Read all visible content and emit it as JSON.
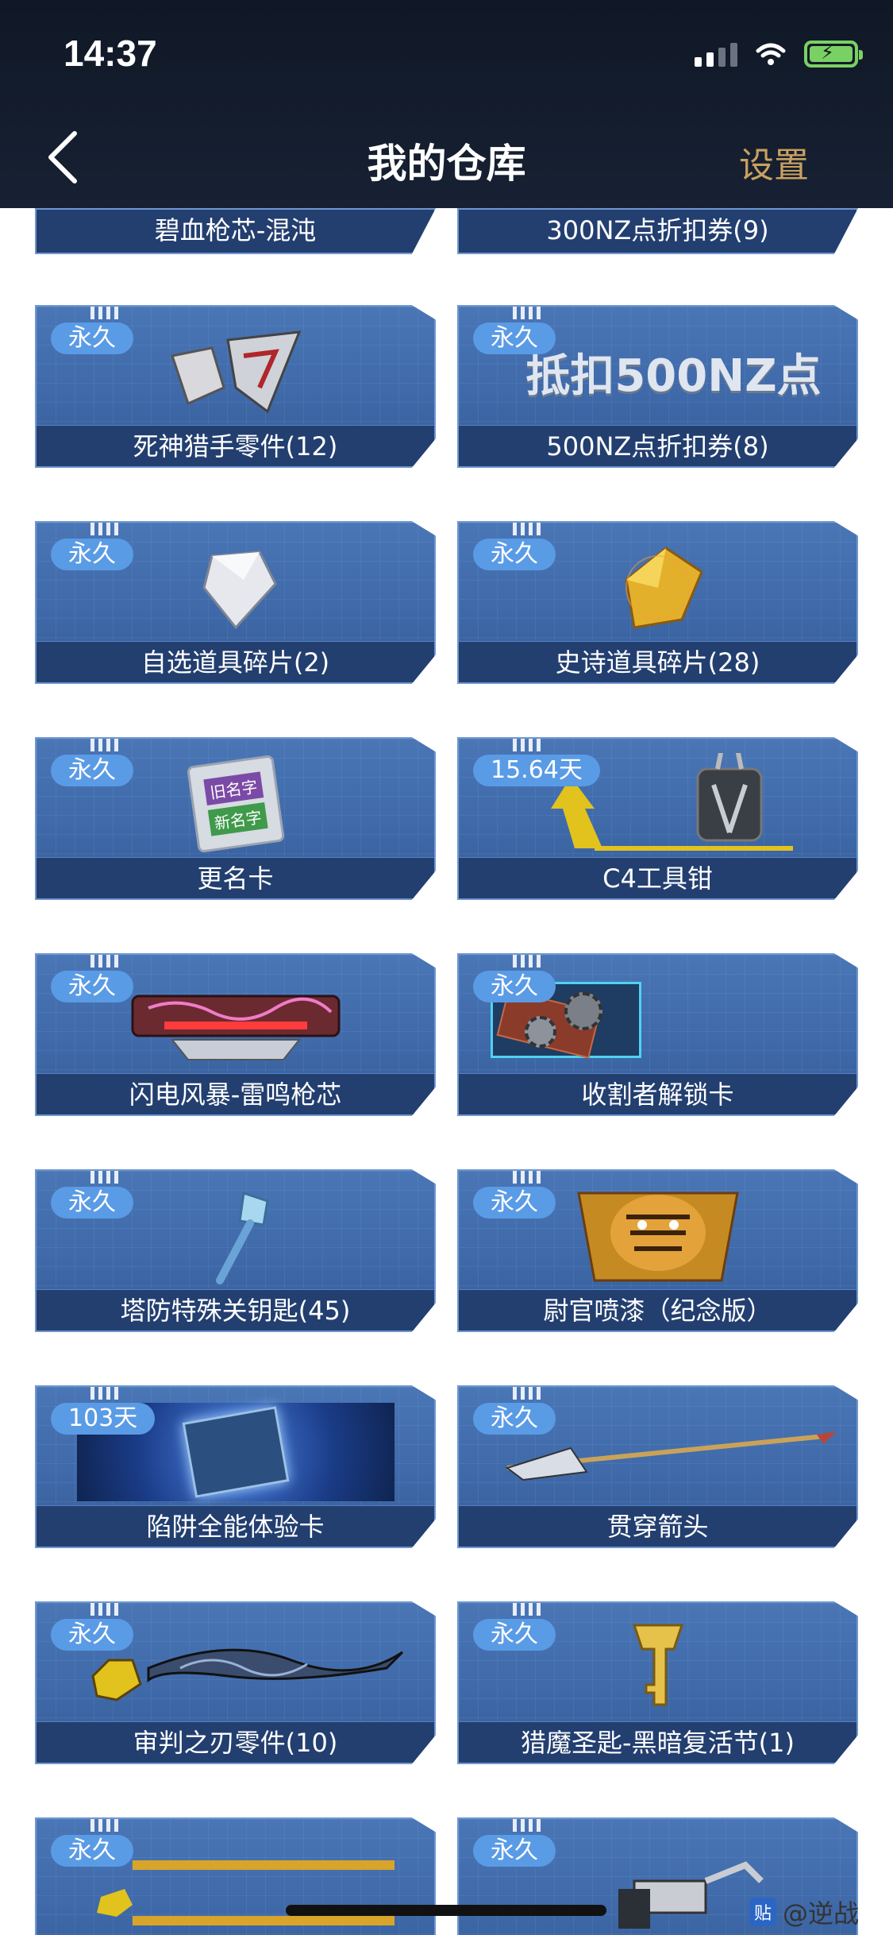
{
  "status_bar": {
    "time": "14:37"
  },
  "nav": {
    "title": "我的仓库",
    "settings_label": "设置"
  },
  "items": [
    {
      "label": "碧血枪芯-混沌"
    },
    {
      "label": "300NZ点折扣券(9)"
    },
    {
      "badge": "永久",
      "label": "死神猎手零件(12)",
      "icon": "armor-part-icon"
    },
    {
      "badge": "永久",
      "label": "500NZ点折扣券(8)",
      "icon": "coupon-icon",
      "art_text": "抵扣500NZ点"
    },
    {
      "badge": "永久",
      "label": "自选道具碎片(2)",
      "icon": "silver-shard-icon"
    },
    {
      "badge": "永久",
      "label": "史诗道具碎片(28)",
      "icon": "gold-shard-icon"
    },
    {
      "badge": "永久",
      "label": "更名卡",
      "icon": "rename-card-icon",
      "art_text_1": "旧名字",
      "art_text_2": "新名字"
    },
    {
      "badge": "15.64天",
      "label": "C4工具钳",
      "icon": "pliers-icon"
    },
    {
      "badge": "永久",
      "label": "闪电风暴-雷鸣枪芯",
      "icon": "gun-core-icon"
    },
    {
      "badge": "永久",
      "label": "收割者解锁卡",
      "icon": "unlock-card-icon"
    },
    {
      "badge": "永久",
      "label": "塔防特殊关钥匙(45)",
      "icon": "key-icon"
    },
    {
      "badge": "永久",
      "label": "尉官喷漆（纪念版）",
      "icon": "tiger-spray-icon"
    },
    {
      "badge": "103天",
      "label": "陷阱全能体验卡",
      "icon": "trap-card-icon"
    },
    {
      "badge": "永久",
      "label": "贯穿箭头",
      "icon": "arrow-icon"
    },
    {
      "badge": "永久",
      "label": "审判之刃零件(10)",
      "icon": "blade-icon"
    },
    {
      "badge": "永久",
      "label": "猎魔圣匙-黑暗复活节(1)",
      "icon": "golden-key-icon"
    },
    {
      "badge": "永久",
      "label": "",
      "icon": "katana-icon"
    },
    {
      "badge": "永久",
      "label": "",
      "icon": "crossbow-icon"
    }
  ],
  "watermark": {
    "badge": "贴",
    "text": "@逆战"
  }
}
